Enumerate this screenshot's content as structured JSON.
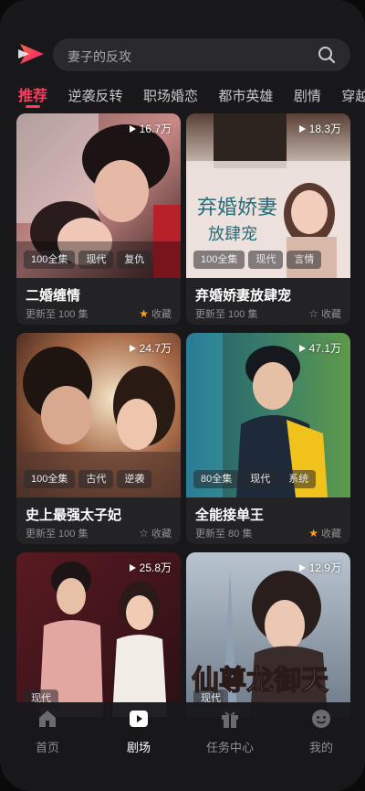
{
  "search": {
    "placeholder": "妻子的反攻"
  },
  "tabs": [
    {
      "label": "推荐",
      "active": true
    },
    {
      "label": "逆袭反转"
    },
    {
      "label": "职场婚恋"
    },
    {
      "label": "都市英雄"
    },
    {
      "label": "剧情"
    },
    {
      "label": "穿越"
    }
  ],
  "cards": [
    {
      "title": "二婚缠情",
      "views": "16.7万",
      "tags": [
        "100全集",
        "现代",
        "复仇"
      ],
      "updated": "更新至 100 集",
      "fav_label": "收藏",
      "favorited": true
    },
    {
      "title": "弃婚娇妻放肆宠",
      "views": "18.3万",
      "tags": [
        "100全集",
        "现代",
        "言情"
      ],
      "updated": "更新至 100 集",
      "fav_label": "收藏",
      "favorited": false,
      "poster_text": [
        "弃",
        "婚",
        "娇妻",
        "放肆宠"
      ]
    },
    {
      "title": "史上最强太子妃",
      "views": "24.7万",
      "tags": [
        "100全集",
        "古代",
        "逆袭"
      ],
      "updated": "更新至 100 集",
      "fav_label": "收藏",
      "favorited": false
    },
    {
      "title": "全能接单王",
      "views": "47.1万",
      "tags": [
        "80全集",
        "现代",
        "系统"
      ],
      "updated": "更新至 80 集",
      "fav_label": "收藏",
      "favorited": true
    },
    {
      "title": "",
      "views": "25.8万",
      "tags": [
        "",
        "现代"
      ],
      "updated": "",
      "fav_label": "",
      "favorited": false
    },
    {
      "title": "",
      "views": "12.9万",
      "tags": [
        "",
        "现代"
      ],
      "updated": "",
      "fav_label": "",
      "favorited": false,
      "poster_text": [
        "仙尊龙御天"
      ]
    }
  ],
  "nav": [
    {
      "label": "首页",
      "icon": "home-icon",
      "active": false
    },
    {
      "label": "剧场",
      "icon": "theater-icon",
      "active": true
    },
    {
      "label": "任务中心",
      "icon": "gift-icon",
      "active": false
    },
    {
      "label": "我的",
      "icon": "profile-icon",
      "active": false
    }
  ],
  "colors": {
    "accent": "#ff3b5c",
    "star": "#f4a31a",
    "bg": "#18181b"
  }
}
